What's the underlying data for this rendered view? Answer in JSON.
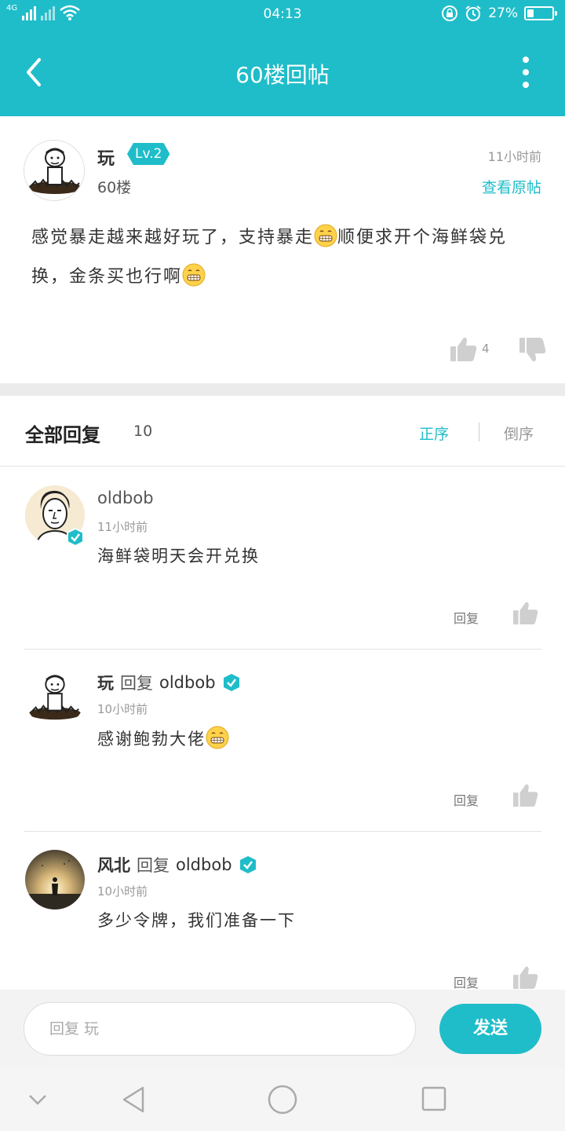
{
  "status_bar": {
    "network": "4G",
    "time": "04:13",
    "battery_text": "27%",
    "battery_level": 0.27
  },
  "header": {
    "title": "60楼回帖"
  },
  "post": {
    "username": "玩",
    "level": "Lv.2",
    "floor": "60楼",
    "time": "11小时前",
    "view_original": "查看原帖",
    "content_part1": "感觉暴走越来越好玩了，支持暴走",
    "content_part2": "顺便求开个海鲜袋兑换，金条买也行啊",
    "like_count": "4"
  },
  "replies_header": {
    "title": "全部回复",
    "count": "10",
    "sort_asc": "正序",
    "sort_desc": "倒序"
  },
  "replies": [
    {
      "author": "oldbob",
      "reply_word": "",
      "target": "",
      "time": "11小时前",
      "text": "海鲜袋明天会开兑换",
      "reply_label": "回复"
    },
    {
      "author": "玩",
      "reply_word": "回复",
      "target": "oldbob",
      "time": "10小时前",
      "text": "感谢鲍勃大佬",
      "reply_label": "回复"
    },
    {
      "author": "风北",
      "reply_word": "回复",
      "target": "oldbob",
      "time": "10小时前",
      "text": "多少令牌，我们准备一下",
      "reply_label": "回复"
    }
  ],
  "input_bar": {
    "placeholder": "回复 玩",
    "send_label": "发送"
  },
  "colors": {
    "accent": "#1fbdc9",
    "divider": "#e2e2e2",
    "band": "#ebebeb"
  }
}
